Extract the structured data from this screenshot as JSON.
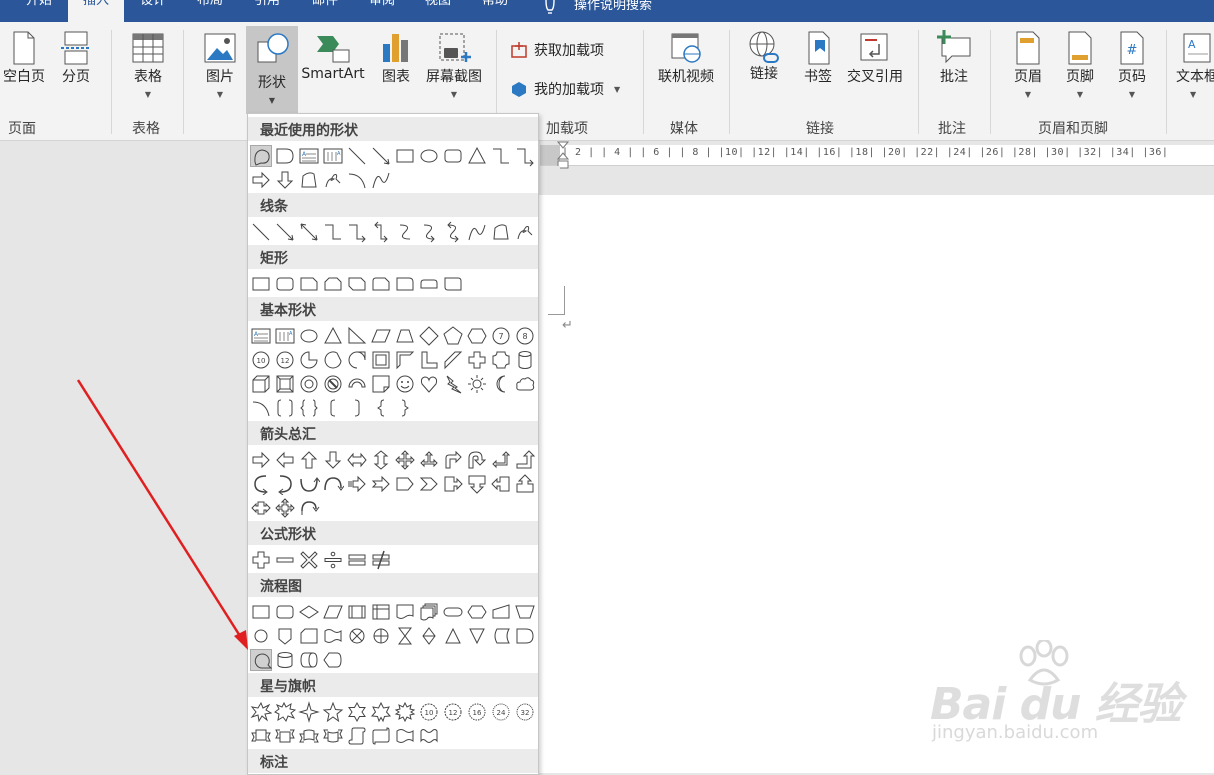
{
  "tabs": [
    "开始",
    "插入",
    "设计",
    "布局",
    "引用",
    "邮件",
    "审阅",
    "视图",
    "帮助"
  ],
  "active_tab": "插入",
  "tell_me": "操作说明搜索",
  "ribbon": {
    "pages": {
      "blank": "空白页",
      "break": "分页",
      "group": "页面"
    },
    "tables": {
      "table": "表格",
      "group": "表格"
    },
    "illus": {
      "picture": "图片",
      "shapes": "形状",
      "smartart": "SmartArt",
      "chart": "图表",
      "screenshot": "屏幕截图"
    },
    "addins": {
      "get": "获取加载项",
      "my": "我的加载项",
      "group": "加载项"
    },
    "media": {
      "video": "联机视频",
      "group": "媒体"
    },
    "links": {
      "link": "链接",
      "bookmark": "书签",
      "xref": "交叉引用",
      "group": "链接"
    },
    "comments": {
      "comment": "批注",
      "group": "批注"
    },
    "hf": {
      "header": "页眉",
      "footer": "页脚",
      "pagenum": "页码",
      "group": "页眉和页脚"
    },
    "text": {
      "textbox": "文本框"
    }
  },
  "ruler": "| 2 |  | 4 |  | 6 |  | 8 |  |10|  |12|  |14|  |16|  |18|  |20|  |22|  |24|  |26|  |28|  |30|  |32|  |34|  |36|",
  "gallery": {
    "recent": "最近使用的形状",
    "lines": "线条",
    "rect": "矩形",
    "basic": "基本形状",
    "arrows": "箭头总汇",
    "equation": "公式形状",
    "flowchart": "流程图",
    "stars": "星与旗帜",
    "callouts": "标注",
    "badges": {
      "n7": "7",
      "n8": "8",
      "n10": "10",
      "n12": "12",
      "s10": "10",
      "s12": "12",
      "s16": "16",
      "s24": "24",
      "s32": "32"
    }
  },
  "watermark": {
    "logo": "Bai du 经验",
    "url": "jingyan.baidu.com"
  },
  "colors": {
    "tabbar": "#2b579a",
    "ribbon": "#f3f3f3",
    "arrow": "#e02020",
    "pressed": "#c6c6c6"
  }
}
